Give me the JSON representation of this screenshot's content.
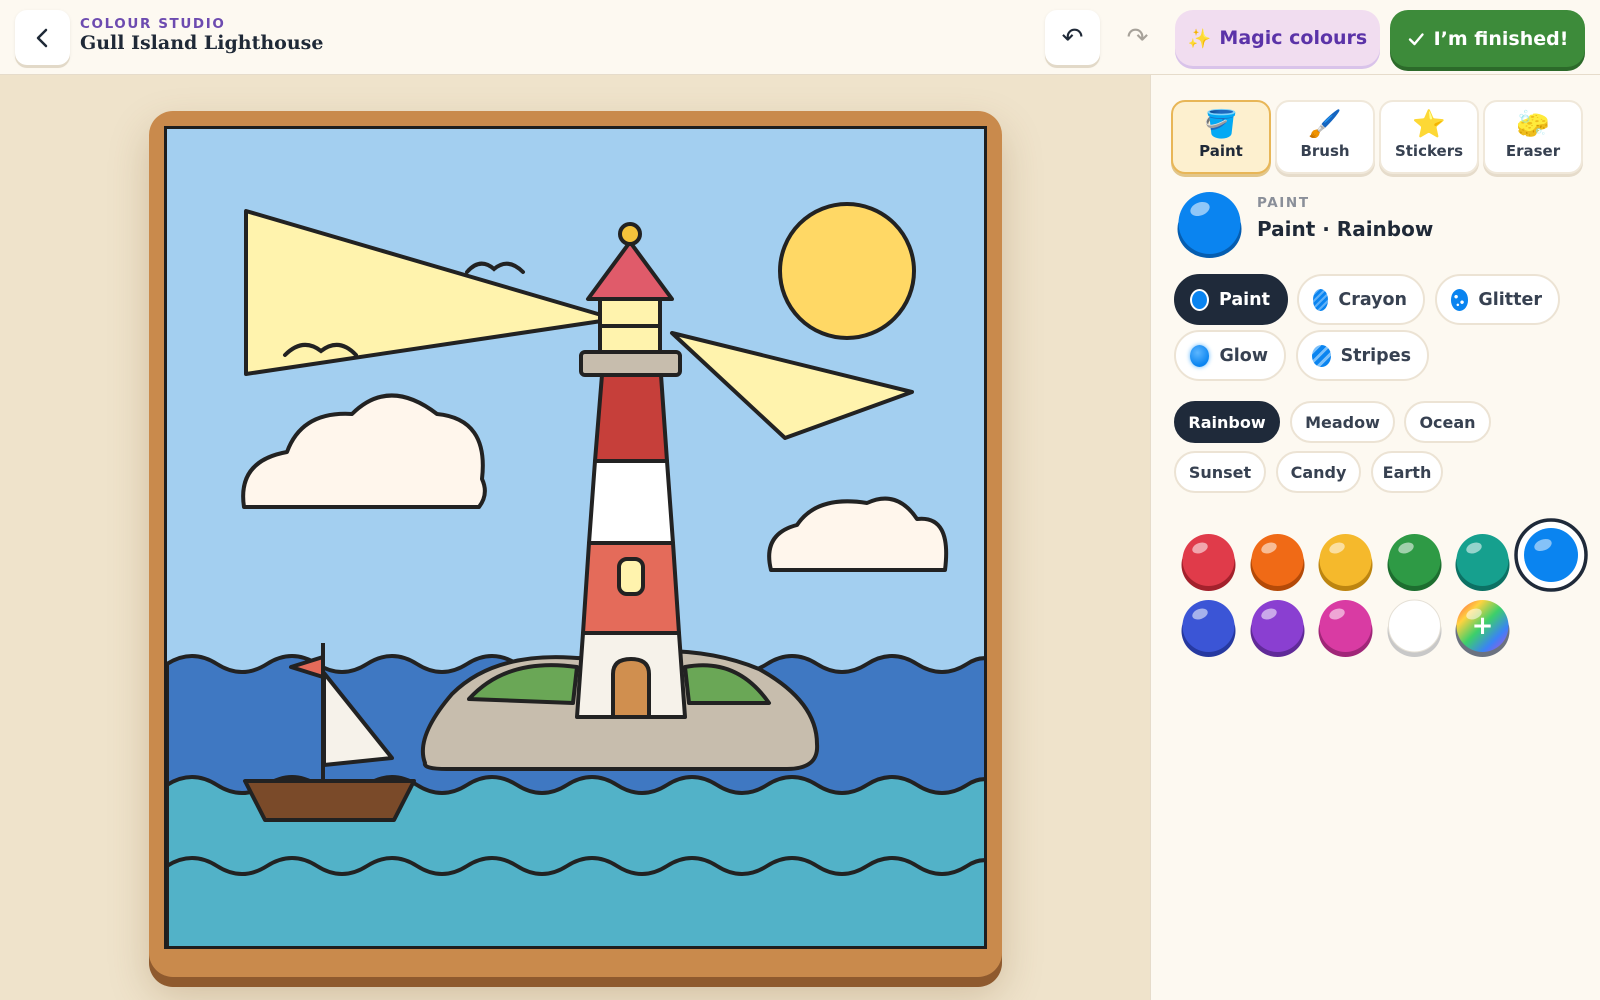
{
  "header": {
    "eyebrow": "COLOUR STUDIO",
    "title": "Gull Island Lighthouse",
    "magic_label": "Magic colours",
    "finish_label": "I’m finished!"
  },
  "tools": [
    {
      "label": "Paint",
      "icon": "paint-bucket-icon",
      "glyph": "🪣",
      "active": true
    },
    {
      "label": "Brush",
      "icon": "paintbrush-icon",
      "glyph": "🖌️",
      "active": false
    },
    {
      "label": "Stickers",
      "icon": "star-icon",
      "glyph": "⭐",
      "active": false
    },
    {
      "label": "Eraser",
      "icon": "sponge-icon",
      "glyph": "🧽",
      "active": false
    }
  ],
  "selection": {
    "caption": "PAINT",
    "name": "Paint · Rainbow",
    "color": "#0a84f0"
  },
  "textures": [
    {
      "label": "Paint",
      "active": true
    },
    {
      "label": "Crayon",
      "active": false
    },
    {
      "label": "Glitter",
      "active": false
    },
    {
      "label": "Glow",
      "active": false
    },
    {
      "label": "Stripes",
      "active": false
    }
  ],
  "palettes": [
    {
      "label": "Rainbow",
      "active": true
    },
    {
      "label": "Meadow",
      "active": false
    },
    {
      "label": "Ocean",
      "active": false
    },
    {
      "label": "Sunset",
      "active": false
    },
    {
      "label": "Candy",
      "active": false
    },
    {
      "label": "Earth",
      "active": false
    }
  ],
  "swatches": [
    {
      "color": "#e03b4a",
      "dark": "#a3212c",
      "selected": false
    },
    {
      "color": "#f06a16",
      "dark": "#b44a08",
      "selected": false
    },
    {
      "color": "#f5b92c",
      "dark": "#bd8510",
      "selected": false
    },
    {
      "color": "#2e9a45",
      "dark": "#1d6e2f",
      "selected": false
    },
    {
      "color": "#16a08e",
      "dark": "#0c7164",
      "selected": false
    },
    {
      "color": "#0a84f0",
      "dark": "#055db0",
      "selected": true
    },
    {
      "color": "#3b55d6",
      "dark": "#2639a0",
      "selected": false
    },
    {
      "color": "#8a3fd1",
      "dark": "#602a98",
      "selected": false
    },
    {
      "color": "#d93ba3",
      "dark": "#a02678",
      "selected": false
    },
    {
      "color": "#ffffff",
      "dark": "#c8c8c8",
      "selected": false
    },
    {
      "color": "rainbow",
      "dark": "#6b7280",
      "selected": false,
      "custom": true
    }
  ],
  "colors": {
    "accent_purple": "#6d4bb0",
    "finish_green": "#3d8b3a",
    "frame_wood": "#c98a4c",
    "sky": "#a3cff0",
    "sea_dark": "#3f78c2",
    "sea_light": "#52b2c8",
    "sun": "#ffd865",
    "beam": "#fff3ad",
    "lighthouse_red": "#c63f3a"
  }
}
